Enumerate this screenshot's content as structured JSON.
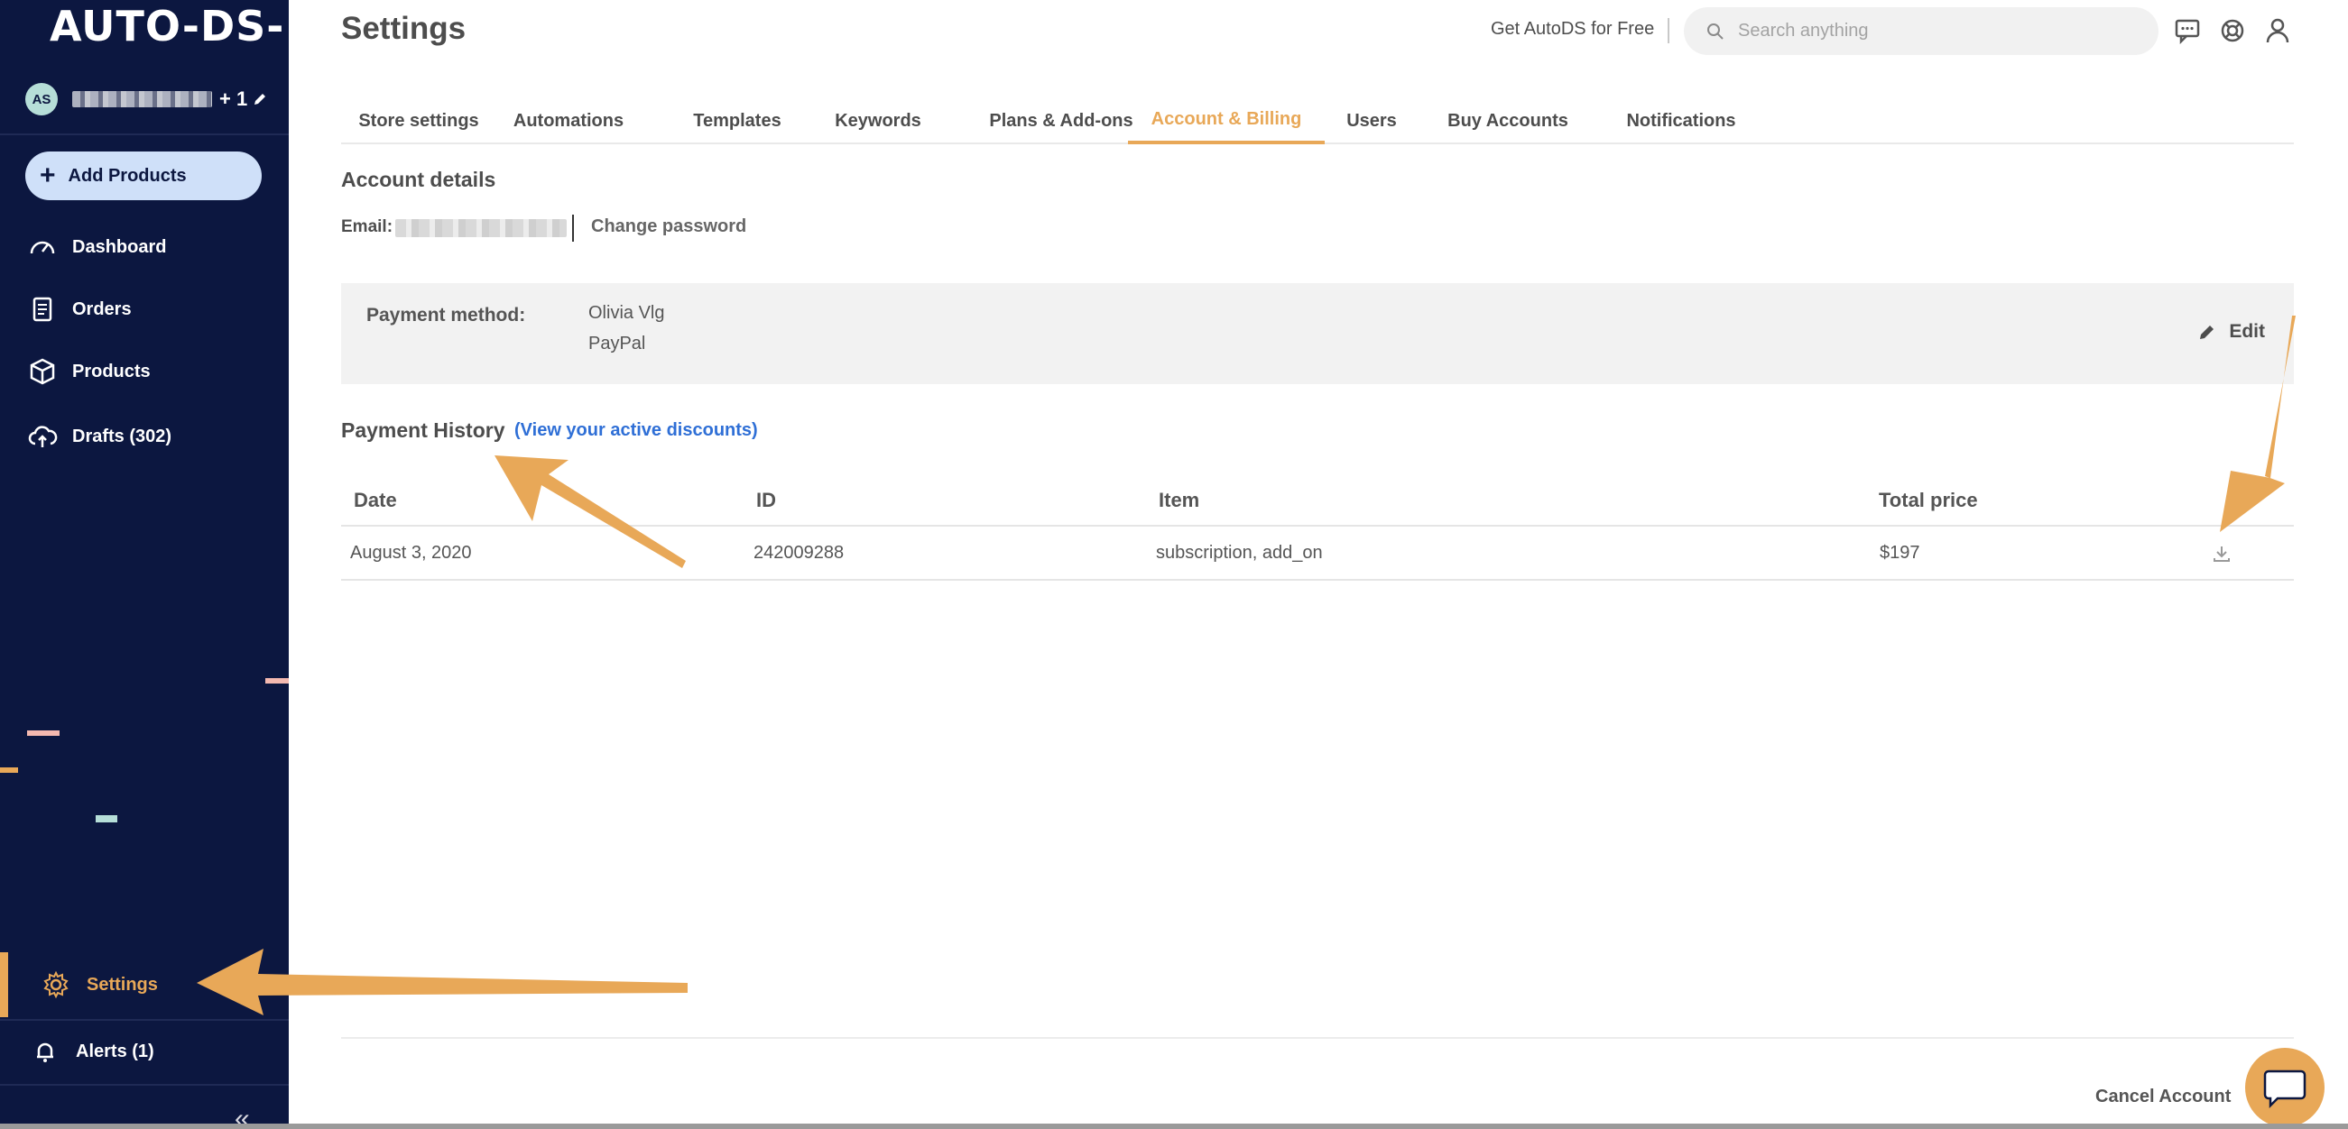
{
  "brand": {
    "logo_text": "AUTO-DS-",
    "accent": "#e8a858",
    "sidebar_bg": "#0c1740",
    "link_color": "#2f6fd6"
  },
  "sidebar": {
    "account": {
      "avatar_initials": "AS",
      "extra_count": "+ 1"
    },
    "add_products": "Add Products",
    "items": [
      {
        "label": "Dashboard",
        "icon": "gauge-icon"
      },
      {
        "label": "Orders",
        "icon": "receipt-icon"
      },
      {
        "label": "Products",
        "icon": "box-icon"
      },
      {
        "label": "Drafts (302)",
        "icon": "cloud-upload-icon"
      }
    ],
    "settings": "Settings",
    "alerts": "Alerts (1)",
    "collapse": "«"
  },
  "header": {
    "title": "Settings",
    "get_free": "Get AutoDS for Free",
    "search_placeholder": "Search anything"
  },
  "tabs": [
    {
      "label": "Store settings",
      "active": false
    },
    {
      "label": "Automations",
      "active": false
    },
    {
      "label": "Templates",
      "active": false
    },
    {
      "label": "Keywords",
      "active": false
    },
    {
      "label": "Plans & Add-ons",
      "active": false
    },
    {
      "label": "Account & Billing",
      "active": true
    },
    {
      "label": "Users",
      "active": false
    },
    {
      "label": "Buy Accounts",
      "active": false
    },
    {
      "label": "Notifications",
      "active": false
    }
  ],
  "account": {
    "title": "Account details",
    "email_label": "Email:",
    "change_password": "Change password",
    "payment_label": "Payment method:",
    "payment_name": "Olivia Vlg",
    "payment_type": "PayPal",
    "edit": "Edit"
  },
  "history": {
    "title": "Payment History",
    "discounts_link": "(View your active discounts)",
    "columns": [
      "Date",
      "ID",
      "Item",
      "Total price"
    ],
    "rows": [
      {
        "date": "August 3, 2020",
        "id": "242009288",
        "item": "subscription, add_on",
        "total": "$197"
      }
    ]
  },
  "footer": {
    "cancel_account": "Cancel Account"
  }
}
